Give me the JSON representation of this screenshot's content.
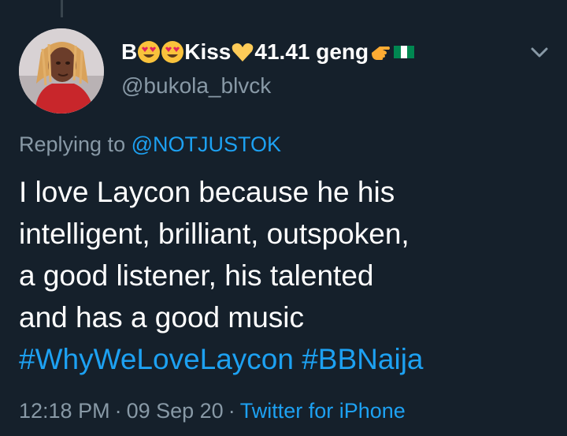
{
  "tweet": {
    "display_name": {
      "prefix": "B",
      "emoji_1": "heart-eyes-emoji",
      "emoji_2": "heart-eyes-emoji",
      "kiss": "Kiss",
      "emoji_3": "yellow-heart-emoji",
      "suffix": "41.41 geng",
      "emoji_4": "pointing-hand-emoji",
      "emoji_5": "nigeria-flag-emoji"
    },
    "handle": "@bukola_blvck",
    "replying_to_label": "Replying to",
    "replying_to_handle": "@NOTJUSTOK",
    "text_lines": [
      "I love Laycon because he his",
      "intelligent, brilliant, outspoken,",
      "a good listener, his talented",
      "and has a good music"
    ],
    "hashtags": [
      "#WhyWeLoveLaycon",
      "#BBNaija"
    ],
    "time": "12:18 PM",
    "date": "09 Sep 20",
    "separator": "·",
    "source": "Twitter for iPhone"
  },
  "colors": {
    "background": "#15202b",
    "text": "#ffffff",
    "muted": "#8899a6",
    "link": "#1da1f2"
  }
}
